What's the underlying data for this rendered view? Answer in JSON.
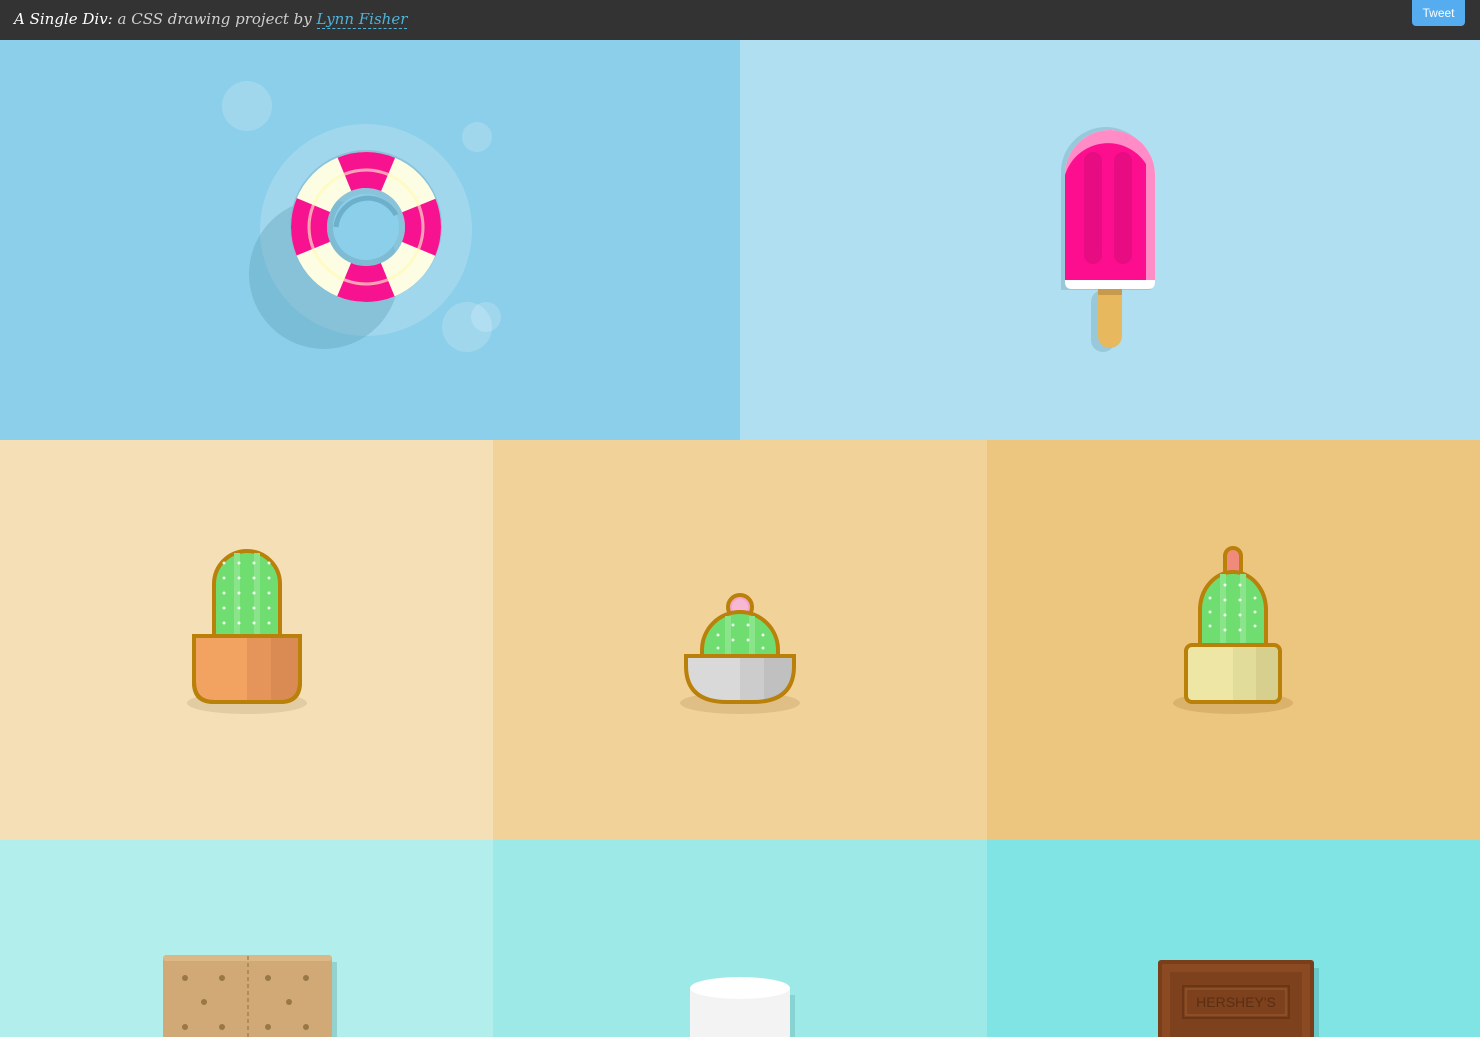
{
  "header": {
    "site_title": "A Single Div:",
    "tagline": " a CSS drawing project by ",
    "author_link": "Lynn Fisher",
    "tweet_label": "Tweet"
  },
  "tiles": [
    {
      "name": "lifesaver",
      "bg": "#8bcfea"
    },
    {
      "name": "popsicle",
      "bg": "#afdff0"
    },
    {
      "name": "cactus-orange-pot",
      "bg": "#f4dfb6"
    },
    {
      "name": "cactus-gray-bowl",
      "bg": "#f1d39a"
    },
    {
      "name": "cactus-yellow-pot",
      "bg": "#ecc67f"
    },
    {
      "name": "graham-cracker",
      "bg": "#b2efec"
    },
    {
      "name": "marshmallow",
      "bg": "#9de9e8"
    },
    {
      "name": "chocolate-bar",
      "bg": "#7fe4e3"
    }
  ],
  "chocolate": {
    "label": "HERSHEY'S"
  },
  "colors": {
    "lifesaver_pink": "#f7128f",
    "popsicle_pink": "#fd0e8e",
    "cactus_green": "#6fdd6f",
    "pot_outline": "#b9800a"
  }
}
